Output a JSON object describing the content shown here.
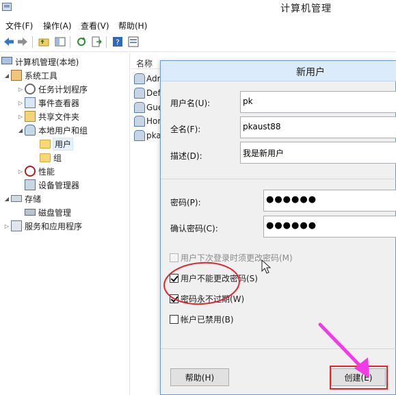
{
  "window": {
    "title": "计算机管理",
    "icon": "computer-management-icon"
  },
  "menu": [
    "文件(F)",
    "操作(A)",
    "查看(V)",
    "帮助(H)"
  ],
  "toolbar": {
    "buttons": [
      "back-icon",
      "forward-icon",
      "up-folder-icon",
      "show-hide-tree-icon",
      "refresh-icon",
      "export-list-icon",
      "help-icon",
      "properties-icon"
    ]
  },
  "tree": {
    "root": "计算机管理(本地)",
    "system_tools": "系统工具",
    "task_scheduler": "任务计划程序",
    "event_viewer": "事件查看器",
    "shared_folders": "共享文件夹",
    "local_users_groups": "本地用户和组",
    "users": "用户",
    "groups": "组",
    "performance": "性能",
    "device_manager": "设备管理器",
    "storage": "存储",
    "disk_management": "磁盘管理",
    "services_apps": "服务和应用程序"
  },
  "list": {
    "col_name": "名称",
    "rows": [
      "Adr",
      "Def",
      "Gue",
      "Hor",
      "pka"
    ]
  },
  "dialog": {
    "title": "新用户",
    "username_label": "用户名(U):",
    "username_value": "pk",
    "fullname_label": "全名(F):",
    "fullname_value": "pkaust88",
    "description_label": "描述(D):",
    "description_value": "我是新用户",
    "password_label": "密码(P):",
    "password_value": "●●●●●●",
    "confirm_label": "确认密码(C):",
    "confirm_value": "●●●●●●",
    "must_change_label": "用户下次登录时须更改密码(M)",
    "must_change_checked": false,
    "cannot_change_label": "用户不能更改密码(S)",
    "cannot_change_checked": true,
    "never_expires_label": "密码永不过期(W)",
    "never_expires_checked": true,
    "disabled_label": "帐户已禁用(B)",
    "disabled_checked": false,
    "help_button": "帮助(H)",
    "create_button": "创建(E)"
  },
  "colors": {
    "annotation_red": "#e0252b",
    "annotation_arrow": "#f13be6",
    "dialog_title_bg": "#dcebfa"
  }
}
